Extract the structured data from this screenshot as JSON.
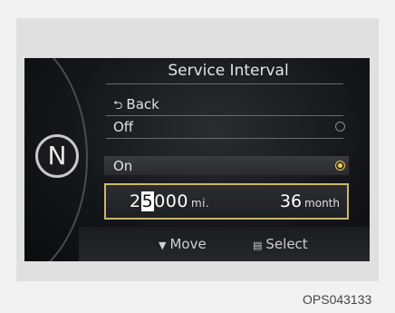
{
  "screen": {
    "title": "Service Interval",
    "back_label": "Back",
    "gear_indicator": "N",
    "options": [
      {
        "label": "Off",
        "selected": false
      },
      {
        "label": "On",
        "selected": true
      }
    ],
    "interval": {
      "miles_prefix": "2",
      "miles_cursor_digit": "5",
      "miles_suffix": "000",
      "miles_unit": "mi.",
      "months_value": "36",
      "months_unit": "month"
    },
    "footer": {
      "move_label": "Move",
      "move_icon": "down-triangle-icon",
      "select_label": "Select",
      "select_icon": "select-button-icon"
    },
    "accent_color": "#f2cf4f"
  },
  "caption": "OPS043133"
}
